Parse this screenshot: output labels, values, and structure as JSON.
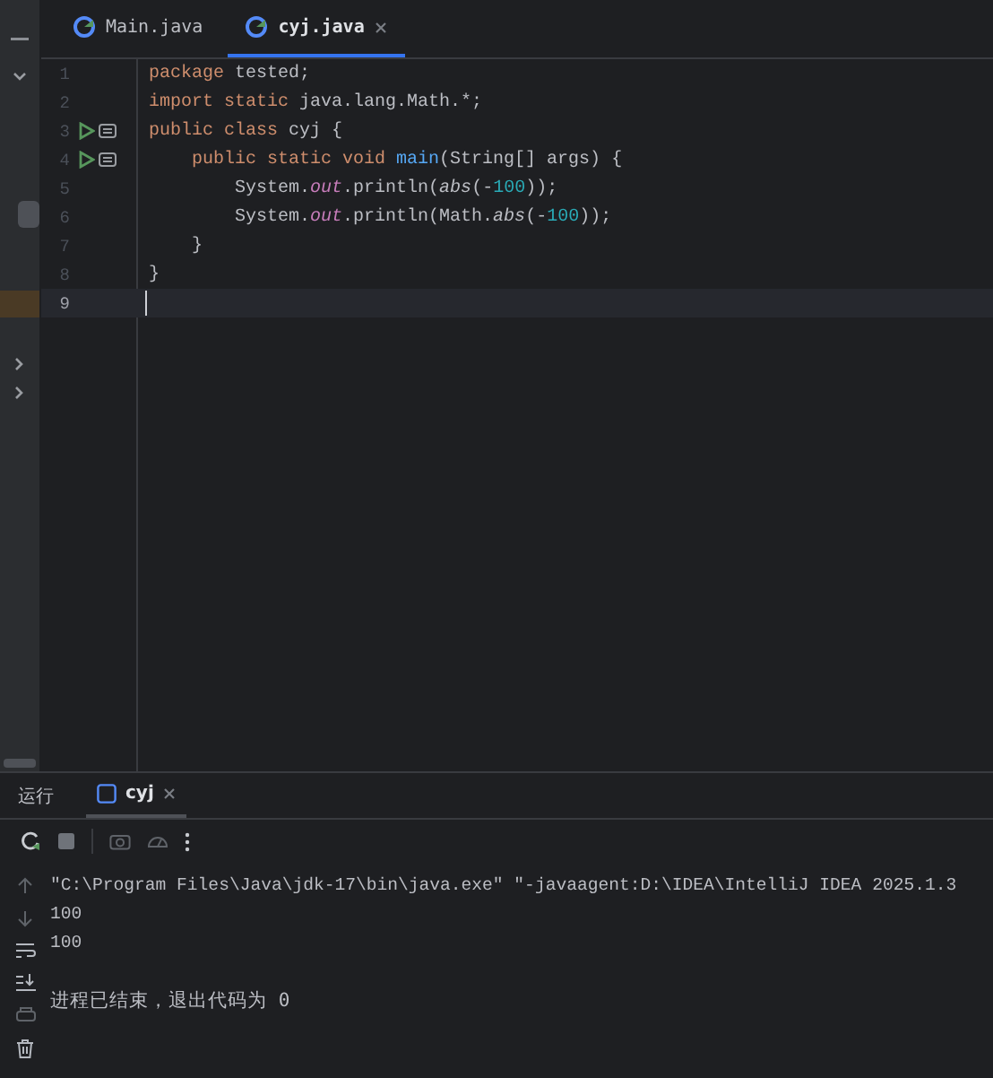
{
  "editor_tabs": [
    {
      "label": "Main.java",
      "selected": false,
      "closable": false
    },
    {
      "label": "cyj.java",
      "selected": true,
      "closable": true
    }
  ],
  "code_lines": [
    {
      "number": "1",
      "runnable": false,
      "current": false,
      "tokens": [
        {
          "text": "package",
          "kind": "keyword"
        },
        {
          "text": " tested;",
          "kind": "plain"
        }
      ]
    },
    {
      "number": "2",
      "runnable": false,
      "current": false,
      "tokens": [
        {
          "text": "import static",
          "kind": "keyword"
        },
        {
          "text": " java.lang.Math.*;",
          "kind": "plain"
        }
      ]
    },
    {
      "number": "3",
      "runnable": true,
      "current": false,
      "tokens": [
        {
          "text": "public class",
          "kind": "keyword"
        },
        {
          "text": " cyj {",
          "kind": "plain"
        }
      ]
    },
    {
      "number": "4",
      "runnable": true,
      "current": false,
      "tokens": [
        {
          "text": "    public static void",
          "kind": "keyword"
        },
        {
          "text": " main",
          "kind": "method"
        },
        {
          "text": "(String[] args) {",
          "kind": "plain"
        }
      ]
    },
    {
      "number": "5",
      "runnable": false,
      "current": false,
      "tokens": [
        {
          "text": "        System.",
          "kind": "plain"
        },
        {
          "text": "out",
          "kind": "field"
        },
        {
          "text": ".println(",
          "kind": "plain"
        },
        {
          "text": "abs",
          "kind": "static"
        },
        {
          "text": "(-",
          "kind": "plain"
        },
        {
          "text": "100",
          "kind": "number"
        },
        {
          "text": "));",
          "kind": "plain"
        }
      ]
    },
    {
      "number": "6",
      "runnable": false,
      "current": false,
      "tokens": [
        {
          "text": "        System.",
          "kind": "plain"
        },
        {
          "text": "out",
          "kind": "field"
        },
        {
          "text": ".println(Math.",
          "kind": "plain"
        },
        {
          "text": "abs",
          "kind": "static"
        },
        {
          "text": "(-",
          "kind": "plain"
        },
        {
          "text": "100",
          "kind": "number"
        },
        {
          "text": "));",
          "kind": "plain"
        }
      ]
    },
    {
      "number": "7",
      "runnable": false,
      "current": false,
      "tokens": [
        {
          "text": "    }",
          "kind": "plain"
        }
      ]
    },
    {
      "number": "8",
      "runnable": false,
      "current": false,
      "tokens": [
        {
          "text": "}",
          "kind": "plain"
        }
      ]
    },
    {
      "number": "9",
      "runnable": false,
      "current": true
    }
  ],
  "run_panel": {
    "title": "运行",
    "tabs": [
      {
        "label": "cyj",
        "selected": true
      }
    ]
  },
  "console_lines": [
    {
      "text": "\"C:\\Program Files\\Java\\jdk-17\\bin\\java.exe\" \"-javaagent:D:\\IDEA\\IntelliJ IDEA 2025.1.3",
      "kind": "command"
    },
    {
      "text": "100",
      "kind": "output"
    },
    {
      "text": "100",
      "kind": "output"
    },
    {
      "text": "进程已结束，退出代码为 0",
      "kind": "exit"
    }
  ]
}
